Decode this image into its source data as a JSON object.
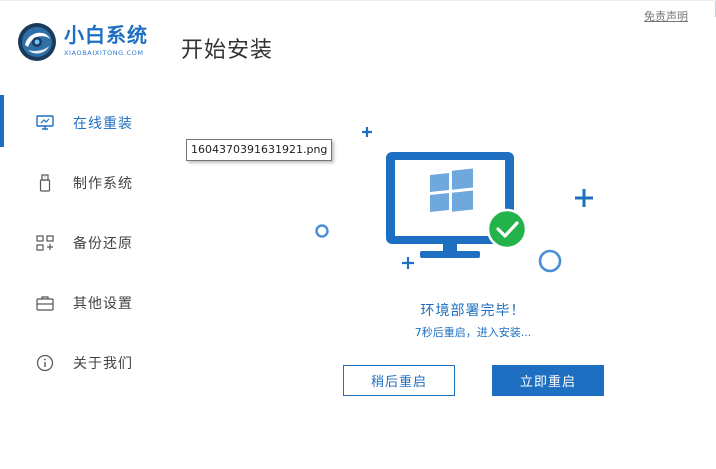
{
  "header": {
    "logo_cn": "小白系统",
    "logo_en": "XIAOBAIXITONG.COM",
    "page_title": "开始安装",
    "disclaimer": "免责声明"
  },
  "sidebar": {
    "items": [
      {
        "label": "在线重装",
        "icon": "monitor-icon",
        "active": true
      },
      {
        "label": "制作系统",
        "icon": "usb-icon",
        "active": false
      },
      {
        "label": "备份还原",
        "icon": "backup-icon",
        "active": false
      },
      {
        "label": "其他设置",
        "icon": "briefcase-icon",
        "active": false
      },
      {
        "label": "关于我们",
        "icon": "info-icon",
        "active": false
      }
    ]
  },
  "tooltip": {
    "text": "1604370391631921.png"
  },
  "status": {
    "title": "环境部署完毕！",
    "subtitle": "7秒后重启，进入安装..."
  },
  "buttons": {
    "later": "稍后重启",
    "now": "立即重启"
  },
  "colors": {
    "accent": "#1e6fc2",
    "success": "#23b34a",
    "text": "#444444"
  }
}
